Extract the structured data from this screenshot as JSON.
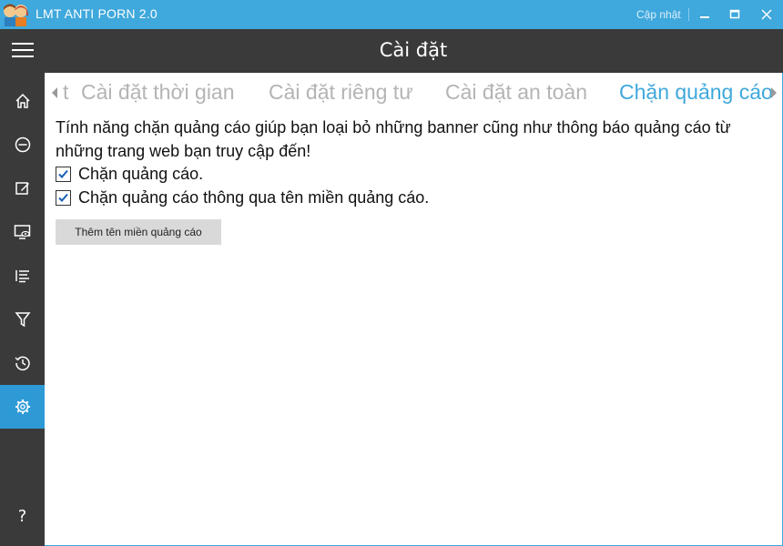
{
  "app": {
    "title": "LMT ANTI PORN 2.0",
    "update_label": "Cập nhật"
  },
  "header": {
    "title": "Cài đặt"
  },
  "sidebar": {
    "items": [
      {
        "icon": "home-icon"
      },
      {
        "icon": "block-icon"
      },
      {
        "icon": "edit-icon"
      },
      {
        "icon": "monitor-eye-icon"
      },
      {
        "icon": "list-icon"
      },
      {
        "icon": "filter-icon"
      },
      {
        "icon": "history-icon"
      },
      {
        "icon": "gear-icon",
        "active": true
      },
      {
        "icon": "help-icon",
        "label": "?"
      }
    ]
  },
  "tabs": [
    {
      "label": "t"
    },
    {
      "label": "Cài đặt thời gian"
    },
    {
      "label": "Cài đặt riêng tư"
    },
    {
      "label": "Cài đặt an toàn"
    },
    {
      "label": "Chặn quảng cáo",
      "active": true
    }
  ],
  "content": {
    "description": "Tính năng chặn quảng cáo giúp bạn loại bỏ những banner cũng như thông báo quảng cáo từ những trang web bạn truy cập đến!",
    "options": [
      {
        "label": "Chặn quảng cáo.",
        "checked": true
      },
      {
        "label": "Chặn quảng cáo thông qua tên miền quảng cáo.",
        "checked": true
      }
    ],
    "add_domain_button": "Thêm tên miền quảng cáo"
  },
  "colors": {
    "accent": "#3fa8dc",
    "dark": "#3a3a3a",
    "active_nav": "#2d9ad6"
  }
}
